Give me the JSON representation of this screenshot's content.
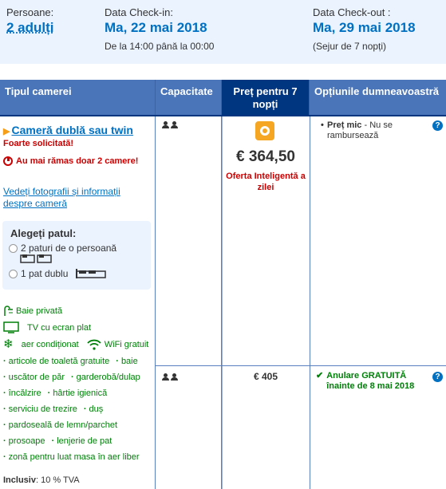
{
  "header": {
    "guests_label": "Persoane:",
    "guests_value": "2 adulți",
    "checkin_label": "Data Check-in:",
    "checkin_value": "Ma, 22 mai 2018",
    "checkin_sub": "De la 14:00 până la 00:00",
    "checkout_label": "Data Check-out :",
    "checkout_value": "Ma, 29 mai 2018",
    "checkout_sub": "(Sejur de 7 nopți)"
  },
  "table_headers": {
    "room_type": "Tipul camerei",
    "capacity": "Capacitate",
    "price": "Preț pentru 7 nopți",
    "options": "Opțiunile dumneavoastră"
  },
  "room": {
    "name": "Cameră dublă sau twin",
    "demand": "Foarte solicitată!",
    "scarcity": "Au mai rămas doar 2 camere!",
    "photos_link": "Vedeți fotografii și informații despre cameră",
    "bed_title": "Alegeți patul:",
    "bed_options": [
      "2 paturi de o persoană",
      "1 pat dublu"
    ]
  },
  "facilities": {
    "f1": "Baie privată",
    "f2": "TV cu ecran plat",
    "f3": "aer condiționat",
    "f4": "WiFi gratuit",
    "f5": "articole de toaletă gratuite",
    "f6": "baie",
    "f7": "uscător de păr",
    "f8": "garderobă/dulap",
    "f9": "încălzire",
    "f10": "hârtie igienică",
    "f11": "serviciu de trezire",
    "f12": "duș",
    "f13": "pardoseală de lemn/parchet",
    "f14": "prosoape",
    "f15": "lenjerie de pat",
    "f16": "zonă pentru luat masa în aer liber"
  },
  "inclusive": {
    "label": "Inclusiv",
    "value": ": 10 % TVA"
  },
  "offers": [
    {
      "price": "€ 364,50",
      "deal": "Oferta Inteligentă a zilei",
      "option_bold": "Preț mic",
      "option_rest": " - Nu se rambursează"
    },
    {
      "price": "€ 405",
      "option": "Anulare GRATUITĂ înainte de 8 mai 2018"
    }
  ],
  "icons": {
    "person": "person-icon",
    "sticker": "smart-deal-icon",
    "help": "help-icon",
    "check": "check-icon"
  },
  "colors": {
    "header_bg": "#4b75b9",
    "header_highlight": "#003580",
    "link": "#0071c2",
    "alert": "#cc0000",
    "facility": "#008009"
  },
  "help_mark": "?"
}
